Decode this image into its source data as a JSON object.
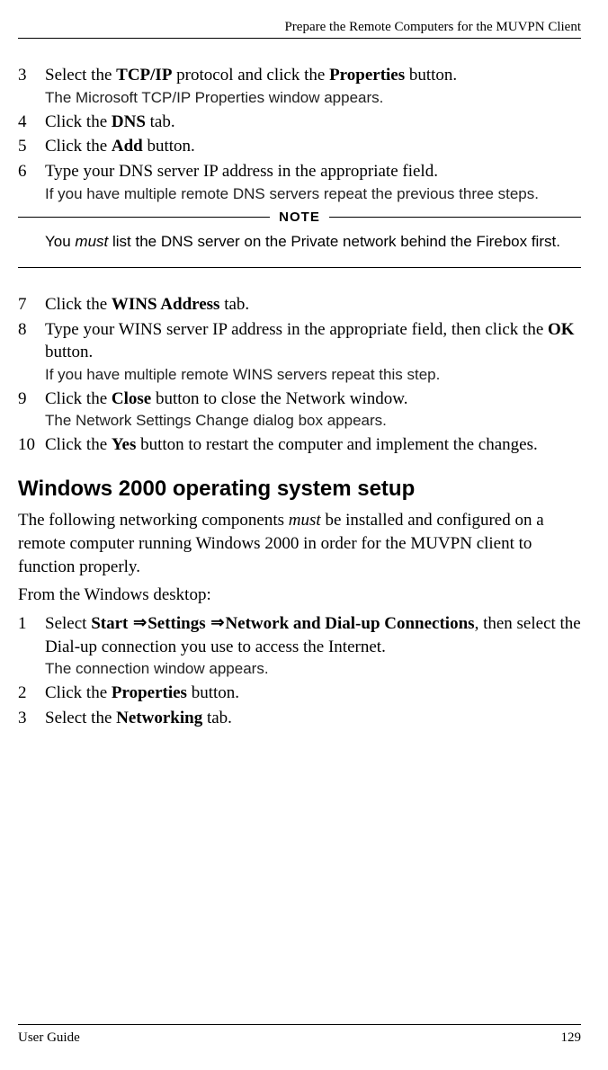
{
  "running_header": "Prepare the Remote Computers for the MUVPN Client",
  "steps_a": [
    {
      "n": "3",
      "pre": "Select the ",
      "b1": "TCP/IP",
      "mid": " protocol and click the ",
      "b2": "Properties",
      "post": " button.",
      "caption": "The Microsoft TCP/IP Properties window appears."
    },
    {
      "n": "4",
      "pre": "Click the ",
      "b1": "DNS",
      "post": " tab."
    },
    {
      "n": "5",
      "pre": "Click the ",
      "b1": "Add",
      "post": " button."
    },
    {
      "n": "6",
      "text": "Type your DNS server IP address in the appropriate field.",
      "caption": "If you have multiple remote DNS servers repeat the previous three steps."
    }
  ],
  "note": {
    "label": "NOTE",
    "pre": "You ",
    "italic": "must",
    "post": " list the DNS server on the Private network behind the Firebox first."
  },
  "steps_b": [
    {
      "n": "7",
      "pre": "Click the ",
      "b1": "WINS Address",
      "post": " tab."
    },
    {
      "n": "8",
      "pre": "Type your WINS server IP address in the appropriate field, then click the ",
      "b1": "OK",
      "post": " button.",
      "caption": "If you have multiple remote WINS servers repeat this step."
    },
    {
      "n": "9",
      "pre": "Click the ",
      "b1": "Close",
      "post": " button to close the Network window.",
      "caption": "The Network Settings Change dialog box appears."
    },
    {
      "n": "10",
      "pre": "Click the ",
      "b1": "Yes",
      "post": " button to restart the computer and implement the changes."
    }
  ],
  "section_heading": "Windows 2000 operating system setup",
  "body_para_1_pre": "The following networking components ",
  "body_para_1_italic": "must",
  "body_para_1_post": " be installed and configured on a remote computer running Windows 2000 in order for the MUVPN client to function properly.",
  "body_para_2": "From the Windows desktop:",
  "steps_c": [
    {
      "n": "1",
      "pre": "Select ",
      "b1": "Start",
      "arrow1": "⇒",
      "b2": "Settings",
      "arrow2": "⇒",
      "b3": "Network and Dial-up Connections",
      "post": ", then select the Dial-up connection you use to access the Internet.",
      "caption": "The connection window appears."
    },
    {
      "n": "2",
      "pre": "Click the ",
      "b1": "Properties",
      "post": " button."
    },
    {
      "n": "3",
      "pre": "Select the ",
      "b1": "Networking",
      "post": " tab."
    }
  ],
  "footer_left": "User Guide",
  "footer_right": "129"
}
